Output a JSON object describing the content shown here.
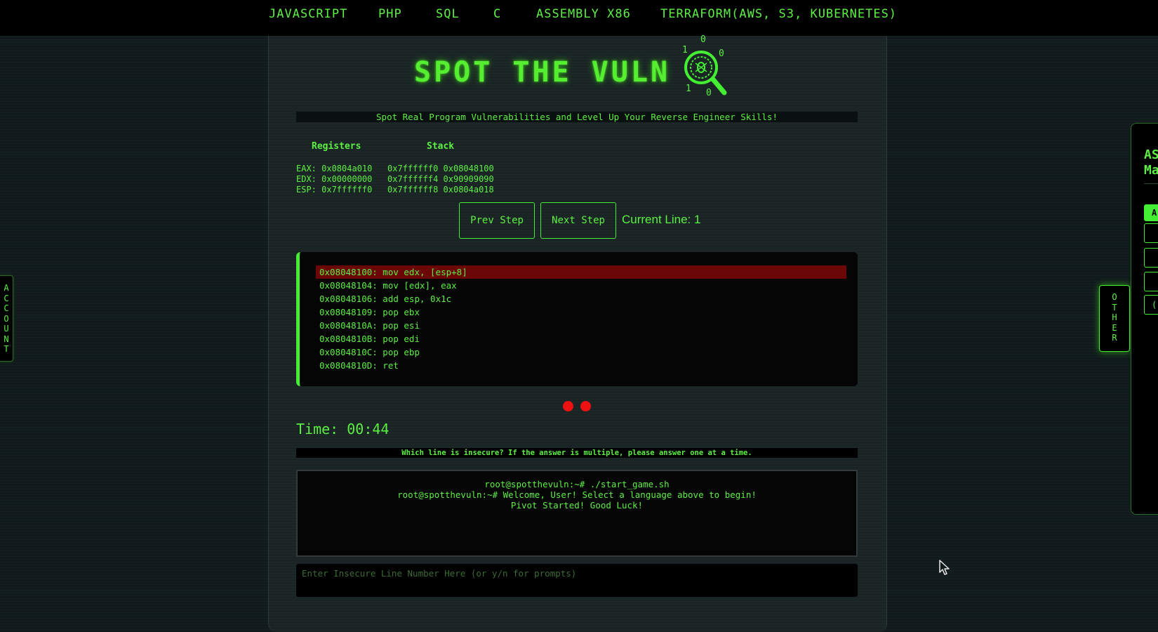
{
  "nav": {
    "items": [
      "JAVASCRIPT",
      "PHP",
      "SQL",
      "C",
      "ASSEMBLY X86",
      "TERRAFORM(AWS, S3, KUBERNETES)"
    ]
  },
  "header": {
    "title": "SPOT THE VULN",
    "logo_digits": [
      "0",
      "1",
      "0",
      "1",
      "0"
    ],
    "subtitle": "Spot Real Program Vulnerabilities and Level Up Your Reverse Engineer Skills!"
  },
  "debugger": {
    "registers_label": "Registers",
    "stack_label": "Stack",
    "rows": [
      "EAX: 0x0804a010   0x7ffffff0 0x08048100",
      "EDX: 0x00000000   0x7ffffff4 0x90909090",
      "ESP: 0x7ffffff0   0x7ffffff8 0x0804a018"
    ],
    "prev_label": "Prev Step",
    "next_label": "Next Step",
    "current_line_text": "Current Line: 1"
  },
  "code": {
    "lines": [
      "0x08048100: mov edx, [esp+8]",
      "0x08048104: mov [edx], eax",
      "0x08048106: add esp, 0x1c",
      "0x08048109: pop ebx",
      "0x0804810A: pop esi",
      "0x0804810B: pop edi",
      "0x0804810C: pop ebp",
      "0x0804810D: ret"
    ],
    "highlighted_line": 1
  },
  "lives": {
    "count": 2,
    "color": "#ee1111"
  },
  "timer": {
    "text": "Time: 00:44"
  },
  "question": "Which line is insecure? If the answer is multiple, please answer one at a time.",
  "terminal": {
    "lines": [
      "root@spotthevuln:~# ./start_game.sh",
      "root@spotthevuln:~# Welcome, User! Select a language above to begin!",
      "Pivot Started! Good Luck!"
    ]
  },
  "answer": {
    "placeholder": "Enter Insecure Line Number Here (or y/n for prompts)",
    "value": ""
  },
  "side_tabs": {
    "left": [
      "A",
      "C",
      "C",
      "O",
      "U",
      "N",
      "T"
    ],
    "right": [
      "O",
      "T",
      "H",
      "E",
      "R"
    ]
  },
  "right_panel": {
    "title_lines": [
      "AS",
      "Ma"
    ],
    "buttons": [
      "A",
      "",
      "",
      "",
      "("
    ]
  },
  "colors": {
    "accent": "#44ee33",
    "highlight": "#6b0707",
    "background": "#111a1c"
  }
}
